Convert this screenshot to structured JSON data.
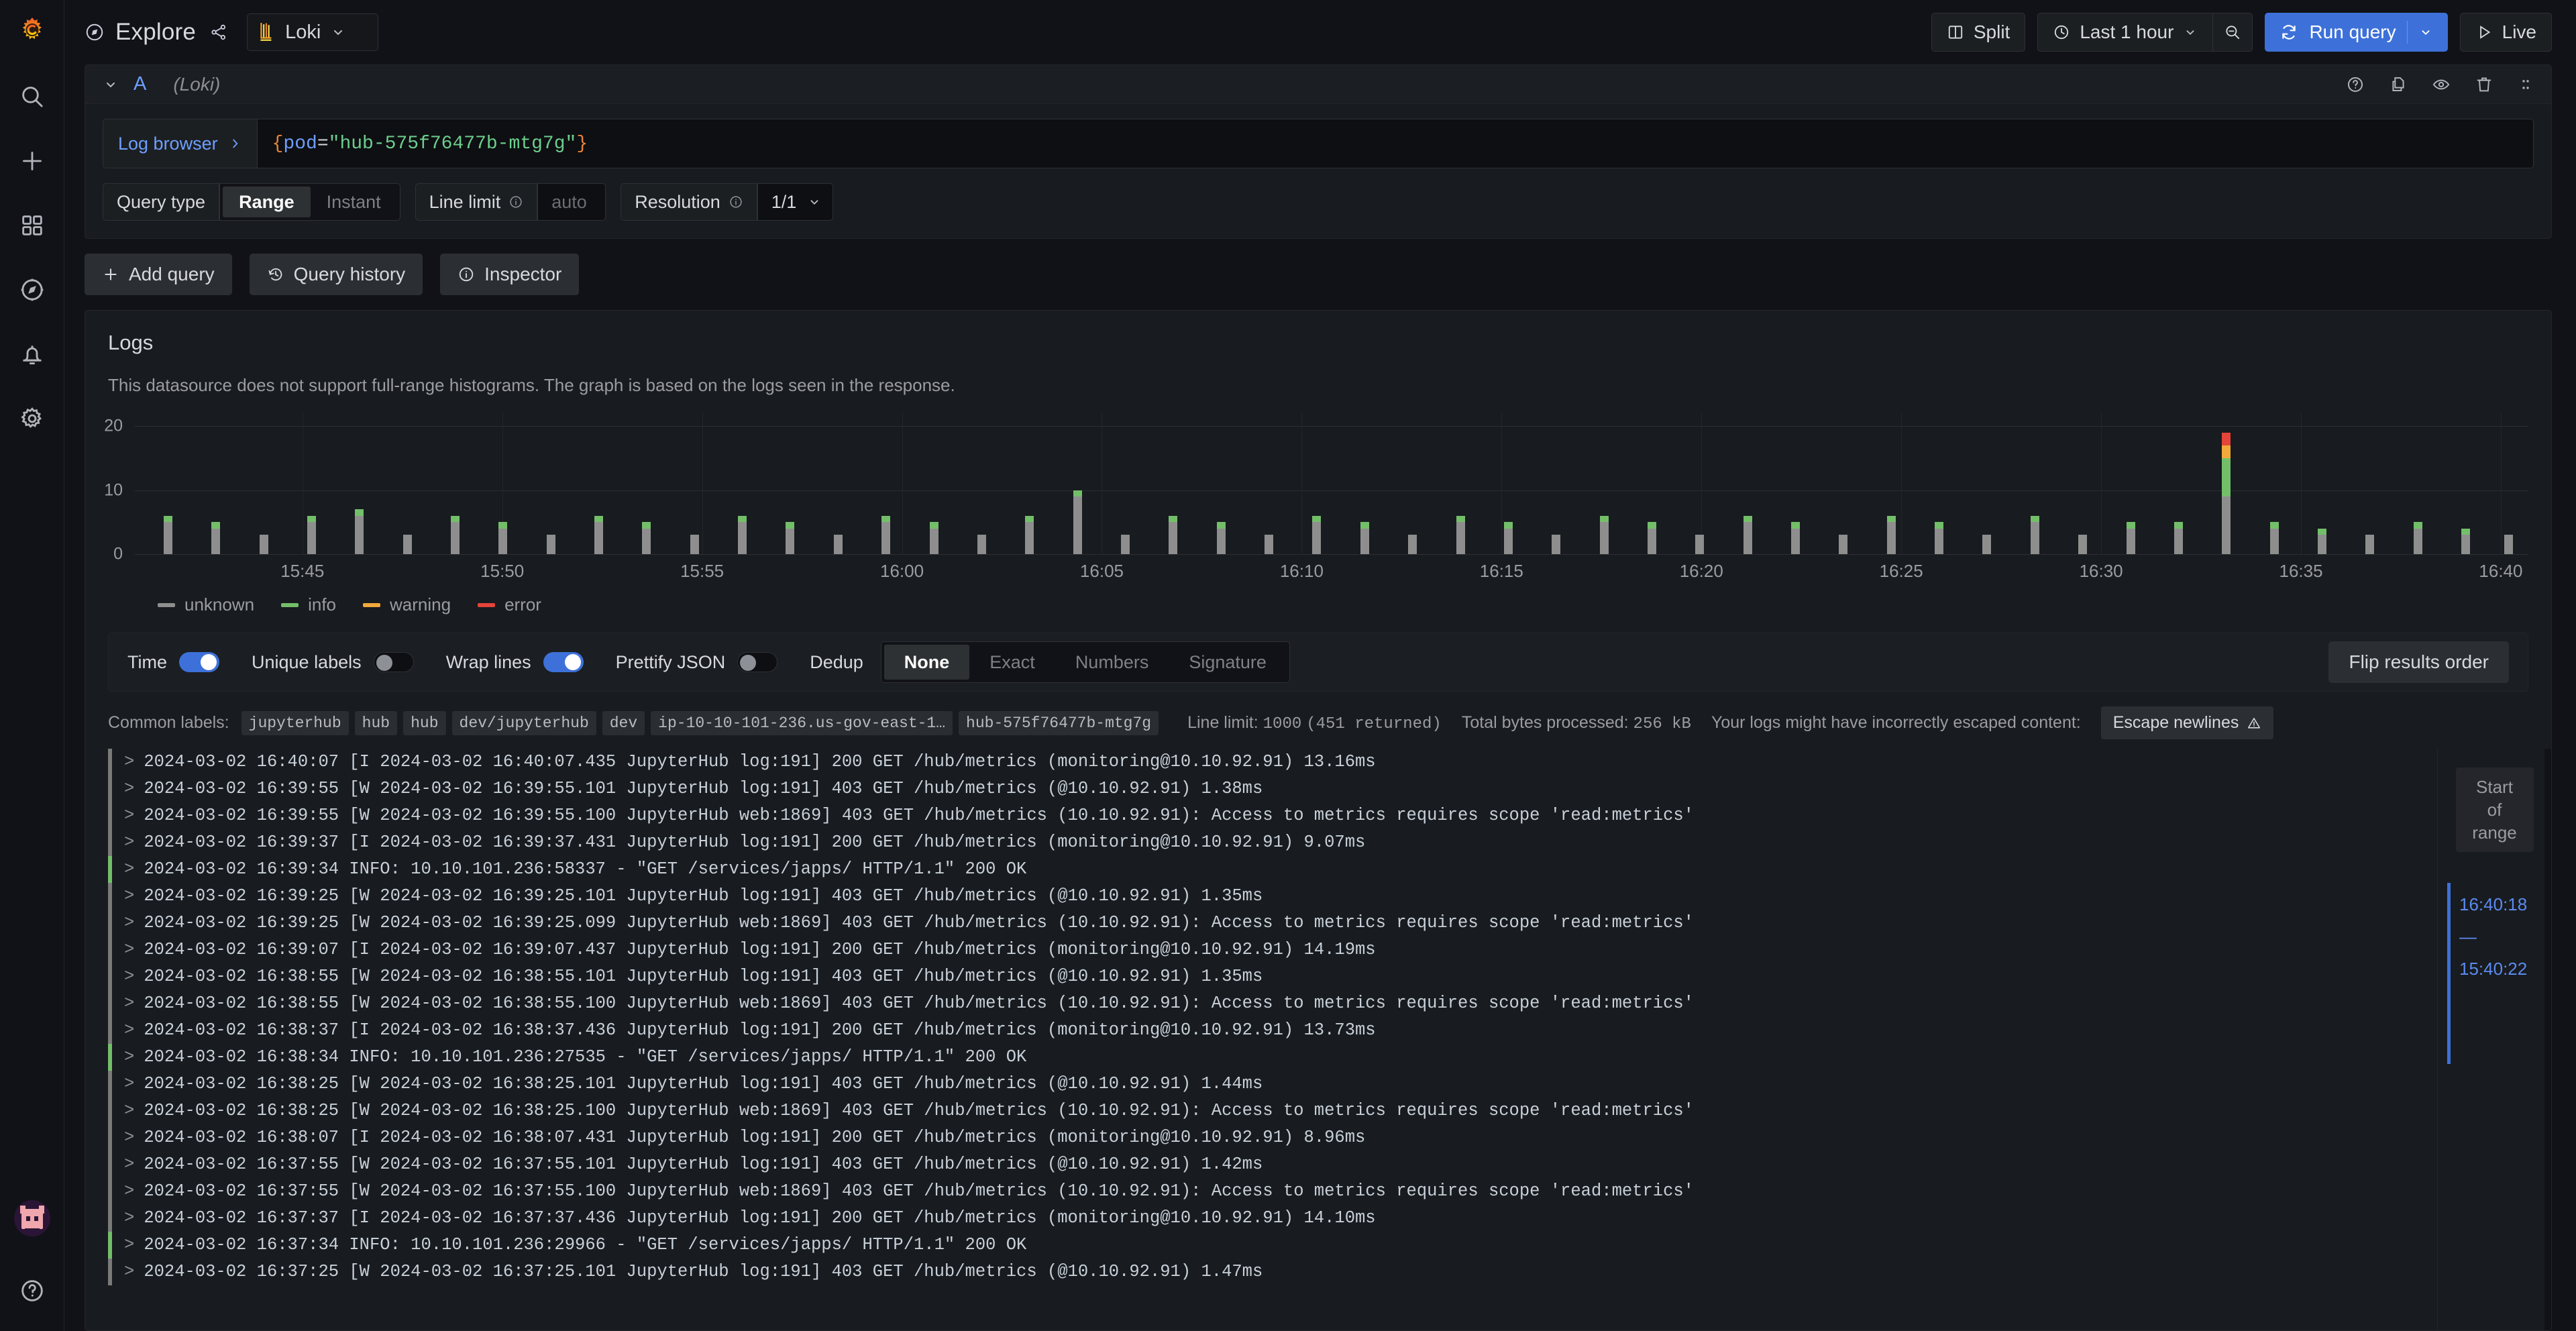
{
  "nav": {
    "logo": "grafana-logo",
    "items": [
      {
        "name": "search-icon",
        "label": "Search"
      },
      {
        "name": "plus-icon",
        "label": "Create"
      },
      {
        "name": "dashboards-icon",
        "label": "Dashboards"
      },
      {
        "name": "explore-icon",
        "label": "Explore"
      },
      {
        "name": "alerting-icon",
        "label": "Alerting"
      },
      {
        "name": "config-icon",
        "label": "Configuration"
      }
    ],
    "bottom": [
      {
        "name": "avatar",
        "label": "User profile"
      },
      {
        "name": "help-icon",
        "label": "Help"
      }
    ]
  },
  "topbar": {
    "title": "Explore",
    "share_icon": "share-icon",
    "compass_icon": "compass-icon",
    "datasource": "Loki",
    "split_label": "Split",
    "time_range": "Last 1 hour",
    "zoom_out_icon": "zoom-out-icon",
    "run_query_label": "Run query",
    "live_label": "Live"
  },
  "query": {
    "ref_id": "A",
    "datasource_note": "(Loki)",
    "log_browser_label": "Log browser",
    "expression": {
      "open_brace": "{",
      "label": "pod",
      "operator": "=",
      "value": "\"hub-575f76477b-mtg7g\"",
      "close_brace": "}"
    },
    "options": {
      "query_type_label": "Query type",
      "query_type_options": [
        "Range",
        "Instant"
      ],
      "query_type_selected": "Range",
      "line_limit_label": "Line limit",
      "line_limit_placeholder": "auto",
      "line_limit_value": "",
      "resolution_label": "Resolution",
      "resolution_value": "1/1"
    },
    "row_tools": [
      "help-icon",
      "duplicate-icon",
      "eye-icon",
      "trash-icon",
      "drag-handle-icon"
    ],
    "actions": [
      {
        "name": "add-query-button",
        "label": "Add query",
        "icon": "plus-icon"
      },
      {
        "name": "query-history-button",
        "label": "Query history",
        "icon": "history-icon"
      },
      {
        "name": "inspector-button",
        "label": "Inspector",
        "icon": "info-icon"
      }
    ]
  },
  "logs": {
    "title": "Logs",
    "note": "This datasource does not support full-range histograms. The graph is based on the logs seen in the response.",
    "controls": {
      "time_label": "Time",
      "time_on": true,
      "unique_labels_label": "Unique labels",
      "unique_labels_on": false,
      "wrap_lines_label": "Wrap lines",
      "wrap_lines_on": true,
      "prettify_json_label": "Prettify JSON",
      "prettify_json_on": false,
      "dedup_label": "Dedup",
      "dedup_options": [
        "None",
        "Exact",
        "Numbers",
        "Signature"
      ],
      "dedup_selected": "None",
      "flip_label": "Flip results order"
    },
    "meta": {
      "common_labels_label": "Common labels:",
      "common_labels": [
        "jupyterhub",
        "hub",
        "hub",
        "dev/jupyterhub",
        "dev",
        "ip-10-10-101-236.us-gov-east-1…",
        "hub-575f76477b-mtg7g"
      ],
      "line_limit_text": "Line limit:",
      "line_limit_value": "1000",
      "returned_text": "(451 returned)",
      "bytes_label": "Total bytes processed:",
      "bytes_value": "256 kB",
      "escape_warning": "Your logs might have incorrectly escaped content:",
      "escape_button": "Escape newlines"
    },
    "minimap": {
      "start_of_range": "Start\nof\nrange",
      "time_top": "16:40:18",
      "time_dash": "—",
      "time_bottom": "15:40:22"
    },
    "rows": [
      {
        "level": "unknown",
        "text": "2024-03-02 16:40:07 [I 2024-03-02 16:40:07.435 JupyterHub log:191] 200 GET /hub/metrics (monitoring@10.10.92.91) 13.16ms"
      },
      {
        "level": "unknown",
        "text": "2024-03-02 16:39:55 [W 2024-03-02 16:39:55.101 JupyterHub log:191] 403 GET /hub/metrics (@10.10.92.91) 1.38ms"
      },
      {
        "level": "unknown",
        "text": "2024-03-02 16:39:55 [W 2024-03-02 16:39:55.100 JupyterHub web:1869] 403 GET /hub/metrics (10.10.92.91): Access to metrics requires scope 'read:metrics'"
      },
      {
        "level": "unknown",
        "text": "2024-03-02 16:39:37 [I 2024-03-02 16:39:37.431 JupyterHub log:191] 200 GET /hub/metrics (monitoring@10.10.92.91) 9.07ms"
      },
      {
        "level": "info",
        "text": "2024-03-02 16:39:34 INFO:     10.10.101.236:58337 - \"GET /services/japps/ HTTP/1.1\" 200 OK"
      },
      {
        "level": "unknown",
        "text": "2024-03-02 16:39:25 [W 2024-03-02 16:39:25.101 JupyterHub log:191] 403 GET /hub/metrics (@10.10.92.91) 1.35ms"
      },
      {
        "level": "unknown",
        "text": "2024-03-02 16:39:25 [W 2024-03-02 16:39:25.099 JupyterHub web:1869] 403 GET /hub/metrics (10.10.92.91): Access to metrics requires scope 'read:metrics'"
      },
      {
        "level": "unknown",
        "text": "2024-03-02 16:39:07 [I 2024-03-02 16:39:07.437 JupyterHub log:191] 200 GET /hub/metrics (monitoring@10.10.92.91) 14.19ms"
      },
      {
        "level": "unknown",
        "text": "2024-03-02 16:38:55 [W 2024-03-02 16:38:55.101 JupyterHub log:191] 403 GET /hub/metrics (@10.10.92.91) 1.35ms"
      },
      {
        "level": "unknown",
        "text": "2024-03-02 16:38:55 [W 2024-03-02 16:38:55.100 JupyterHub web:1869] 403 GET /hub/metrics (10.10.92.91): Access to metrics requires scope 'read:metrics'"
      },
      {
        "level": "unknown",
        "text": "2024-03-02 16:38:37 [I 2024-03-02 16:38:37.436 JupyterHub log:191] 200 GET /hub/metrics (monitoring@10.10.92.91) 13.73ms"
      },
      {
        "level": "info",
        "text": "2024-03-02 16:38:34 INFO:     10.10.101.236:27535 - \"GET /services/japps/ HTTP/1.1\" 200 OK"
      },
      {
        "level": "unknown",
        "text": "2024-03-02 16:38:25 [W 2024-03-02 16:38:25.101 JupyterHub log:191] 403 GET /hub/metrics (@10.10.92.91) 1.44ms"
      },
      {
        "level": "unknown",
        "text": "2024-03-02 16:38:25 [W 2024-03-02 16:38:25.100 JupyterHub web:1869] 403 GET /hub/metrics (10.10.92.91): Access to metrics requires scope 'read:metrics'"
      },
      {
        "level": "unknown",
        "text": "2024-03-02 16:38:07 [I 2024-03-02 16:38:07.431 JupyterHub log:191] 200 GET /hub/metrics (monitoring@10.10.92.91) 8.96ms"
      },
      {
        "level": "unknown",
        "text": "2024-03-02 16:37:55 [W 2024-03-02 16:37:55.101 JupyterHub log:191] 403 GET /hub/metrics (@10.10.92.91) 1.42ms"
      },
      {
        "level": "unknown",
        "text": "2024-03-02 16:37:55 [W 2024-03-02 16:37:55.100 JupyterHub web:1869] 403 GET /hub/metrics (10.10.92.91): Access to metrics requires scope 'read:metrics'"
      },
      {
        "level": "unknown",
        "text": "2024-03-02 16:37:37 [I 2024-03-02 16:37:37.436 JupyterHub log:191] 200 GET /hub/metrics (monitoring@10.10.92.91) 14.10ms"
      },
      {
        "level": "info",
        "text": "2024-03-02 16:37:34 INFO:     10.10.101.236:29966 - \"GET /services/japps/ HTTP/1.1\" 200 OK"
      },
      {
        "level": "unknown",
        "text": "2024-03-02 16:37:25 [W 2024-03-02 16:37:25.101 JupyterHub log:191] 403 GET /hub/metrics (@10.10.92.91) 1.47ms"
      }
    ]
  },
  "chart_data": {
    "type": "bar",
    "title": "",
    "stacked": true,
    "xlabel": "",
    "ylabel": "",
    "ylim": [
      0,
      22
    ],
    "yticks": [
      0,
      10,
      20
    ],
    "grid": true,
    "legend_position": "bottom",
    "x_tick_labels": [
      "15:45",
      "15:50",
      "15:55",
      "16:00",
      "16:05",
      "16:10",
      "16:15",
      "16:20",
      "16:25",
      "16:30",
      "16:35",
      "16:40"
    ],
    "x_tick_positions_pct": [
      7.0,
      15.35,
      23.7,
      32.05,
      40.4,
      48.75,
      57.1,
      65.45,
      73.8,
      82.15,
      90.5,
      98.85
    ],
    "series": [
      {
        "name": "unknown",
        "color": "#8e8e8e"
      },
      {
        "name": "info",
        "color": "#73bf69"
      },
      {
        "name": "warning",
        "color": "#f2a93b"
      },
      {
        "name": "error",
        "color": "#e5443a"
      }
    ],
    "bars": [
      {
        "x_pct": 1.2,
        "unknown": 5,
        "info": 1,
        "warning": 0,
        "error": 0
      },
      {
        "x_pct": 3.2,
        "unknown": 4,
        "info": 1,
        "warning": 0,
        "error": 0
      },
      {
        "x_pct": 5.2,
        "unknown": 3,
        "info": 0,
        "warning": 0,
        "error": 0
      },
      {
        "x_pct": 7.2,
        "unknown": 5,
        "info": 1,
        "warning": 0,
        "error": 0
      },
      {
        "x_pct": 9.2,
        "unknown": 6,
        "info": 1,
        "warning": 0,
        "error": 0
      },
      {
        "x_pct": 11.2,
        "unknown": 3,
        "info": 0,
        "warning": 0,
        "error": 0
      },
      {
        "x_pct": 13.2,
        "unknown": 5,
        "info": 1,
        "warning": 0,
        "error": 0
      },
      {
        "x_pct": 15.2,
        "unknown": 4,
        "info": 1,
        "warning": 0,
        "error": 0
      },
      {
        "x_pct": 17.2,
        "unknown": 3,
        "info": 0,
        "warning": 0,
        "error": 0
      },
      {
        "x_pct": 19.2,
        "unknown": 5,
        "info": 1,
        "warning": 0,
        "error": 0
      },
      {
        "x_pct": 21.2,
        "unknown": 4,
        "info": 1,
        "warning": 0,
        "error": 0
      },
      {
        "x_pct": 23.2,
        "unknown": 3,
        "info": 0,
        "warning": 0,
        "error": 0
      },
      {
        "x_pct": 25.2,
        "unknown": 5,
        "info": 1,
        "warning": 0,
        "error": 0
      },
      {
        "x_pct": 27.2,
        "unknown": 4,
        "info": 1,
        "warning": 0,
        "error": 0
      },
      {
        "x_pct": 29.2,
        "unknown": 3,
        "info": 0,
        "warning": 0,
        "error": 0
      },
      {
        "x_pct": 31.2,
        "unknown": 5,
        "info": 1,
        "warning": 0,
        "error": 0
      },
      {
        "x_pct": 33.2,
        "unknown": 4,
        "info": 1,
        "warning": 0,
        "error": 0
      },
      {
        "x_pct": 35.2,
        "unknown": 3,
        "info": 0,
        "warning": 0,
        "error": 0
      },
      {
        "x_pct": 37.2,
        "unknown": 5,
        "info": 1,
        "warning": 0,
        "error": 0
      },
      {
        "x_pct": 39.2,
        "unknown": 9,
        "info": 1,
        "warning": 0,
        "error": 0
      },
      {
        "x_pct": 41.2,
        "unknown": 3,
        "info": 0,
        "warning": 0,
        "error": 0
      },
      {
        "x_pct": 43.2,
        "unknown": 5,
        "info": 1,
        "warning": 0,
        "error": 0
      },
      {
        "x_pct": 45.2,
        "unknown": 4,
        "info": 1,
        "warning": 0,
        "error": 0
      },
      {
        "x_pct": 47.2,
        "unknown": 3,
        "info": 0,
        "warning": 0,
        "error": 0
      },
      {
        "x_pct": 49.2,
        "unknown": 5,
        "info": 1,
        "warning": 0,
        "error": 0
      },
      {
        "x_pct": 51.2,
        "unknown": 4,
        "info": 1,
        "warning": 0,
        "error": 0
      },
      {
        "x_pct": 53.2,
        "unknown": 3,
        "info": 0,
        "warning": 0,
        "error": 0
      },
      {
        "x_pct": 55.2,
        "unknown": 5,
        "info": 1,
        "warning": 0,
        "error": 0
      },
      {
        "x_pct": 57.2,
        "unknown": 4,
        "info": 1,
        "warning": 0,
        "error": 0
      },
      {
        "x_pct": 59.2,
        "unknown": 3,
        "info": 0,
        "warning": 0,
        "error": 0
      },
      {
        "x_pct": 61.2,
        "unknown": 5,
        "info": 1,
        "warning": 0,
        "error": 0
      },
      {
        "x_pct": 63.2,
        "unknown": 4,
        "info": 1,
        "warning": 0,
        "error": 0
      },
      {
        "x_pct": 65.2,
        "unknown": 3,
        "info": 0,
        "warning": 0,
        "error": 0
      },
      {
        "x_pct": 67.2,
        "unknown": 5,
        "info": 1,
        "warning": 0,
        "error": 0
      },
      {
        "x_pct": 69.2,
        "unknown": 4,
        "info": 1,
        "warning": 0,
        "error": 0
      },
      {
        "x_pct": 71.2,
        "unknown": 3,
        "info": 0,
        "warning": 0,
        "error": 0
      },
      {
        "x_pct": 73.2,
        "unknown": 5,
        "info": 1,
        "warning": 0,
        "error": 0
      },
      {
        "x_pct": 75.2,
        "unknown": 4,
        "info": 1,
        "warning": 0,
        "error": 0
      },
      {
        "x_pct": 77.2,
        "unknown": 3,
        "info": 0,
        "warning": 0,
        "error": 0
      },
      {
        "x_pct": 79.2,
        "unknown": 5,
        "info": 1,
        "warning": 0,
        "error": 0
      },
      {
        "x_pct": 81.2,
        "unknown": 3,
        "info": 0,
        "warning": 0,
        "error": 0
      },
      {
        "x_pct": 83.2,
        "unknown": 4,
        "info": 1,
        "warning": 0,
        "error": 0
      },
      {
        "x_pct": 85.2,
        "unknown": 4,
        "info": 1,
        "warning": 0,
        "error": 0
      },
      {
        "x_pct": 87.2,
        "unknown": 9,
        "info": 6,
        "warning": 2,
        "error": 2
      },
      {
        "x_pct": 89.2,
        "unknown": 4,
        "info": 1,
        "warning": 0,
        "error": 0
      },
      {
        "x_pct": 91.2,
        "unknown": 3,
        "info": 1,
        "warning": 0,
        "error": 0
      },
      {
        "x_pct": 93.2,
        "unknown": 3,
        "info": 0,
        "warning": 0,
        "error": 0
      },
      {
        "x_pct": 95.2,
        "unknown": 4,
        "info": 1,
        "warning": 0,
        "error": 0
      },
      {
        "x_pct": 97.2,
        "unknown": 3,
        "info": 1,
        "warning": 0,
        "error": 0
      },
      {
        "x_pct": 99.0,
        "unknown": 3,
        "info": 0,
        "warning": 0,
        "error": 0
      }
    ]
  }
}
